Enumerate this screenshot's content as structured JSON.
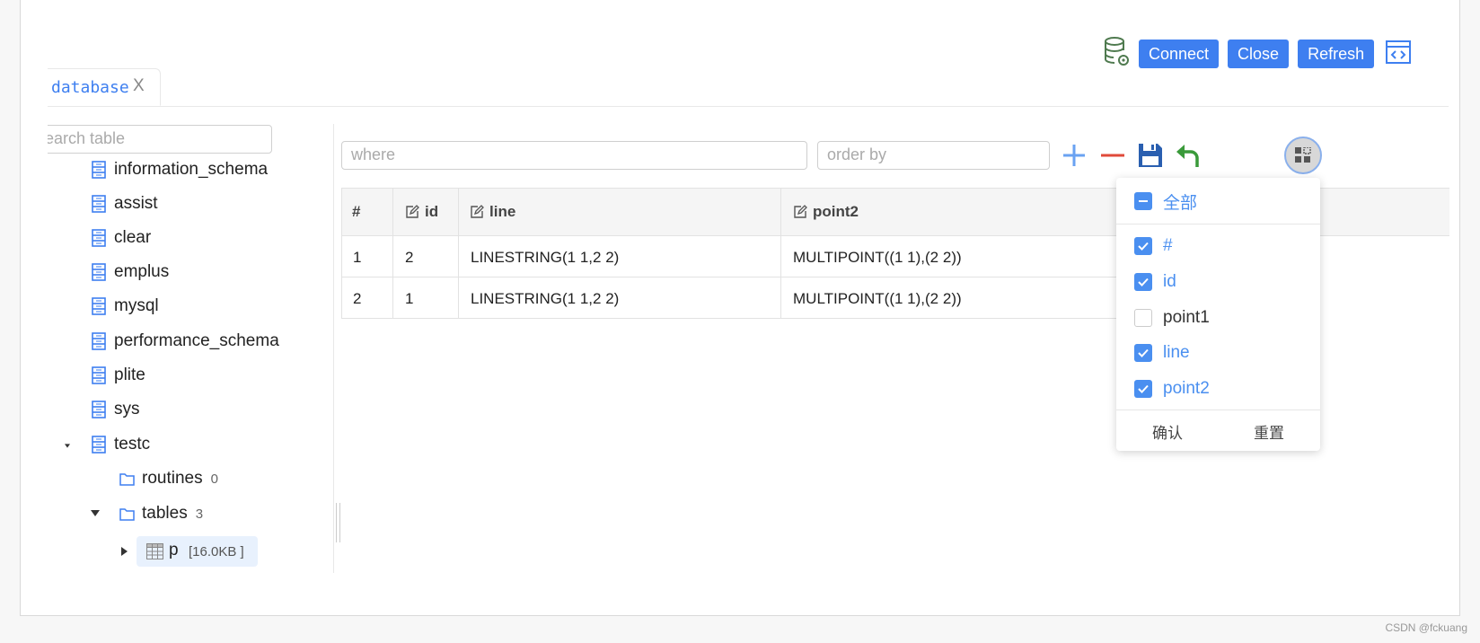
{
  "toolbar": {
    "connect_label": "Connect",
    "close_label": "Close",
    "refresh_label": "Refresh"
  },
  "tab": {
    "label": "database",
    "close": "X"
  },
  "sidebar": {
    "search_placeholder": "search table",
    "search_visible": "earch table",
    "databases": [
      "information_schema",
      "assist",
      "clear",
      "emplus",
      "mysql",
      "performance_schema",
      "plite",
      "sys",
      "testc"
    ],
    "folders": [
      {
        "label": "routines",
        "count": "0"
      },
      {
        "label": "tables",
        "count": "3"
      }
    ],
    "table": {
      "name": "p",
      "size": "[16.0KB ]"
    }
  },
  "filters": {
    "where_placeholder": "where",
    "orderby_placeholder": "order by"
  },
  "grid": {
    "columns": [
      "#",
      "id",
      "line",
      "point2"
    ],
    "rows": [
      [
        "1",
        "2",
        "LINESTRING(1 1,2 2)",
        "MULTIPOINT((1 1),(2 2))"
      ],
      [
        "2",
        "1",
        "LINESTRING(1 1,2 2)",
        "MULTIPOINT((1 1),(2 2))"
      ]
    ]
  },
  "column_picker": {
    "all_label": "全部",
    "options": [
      {
        "label": "#",
        "checked": true
      },
      {
        "label": "id",
        "checked": true
      },
      {
        "label": "point1",
        "checked": false
      },
      {
        "label": "line",
        "checked": true
      },
      {
        "label": "point2",
        "checked": true
      }
    ],
    "confirm_label": "确认",
    "reset_label": "重置"
  },
  "watermark": "CSDN @fckuang",
  "colors": {
    "accent": "#3e7ff0",
    "danger": "#e04a3a",
    "save": "#2a5fb0",
    "undo": "#3a9a3a"
  }
}
